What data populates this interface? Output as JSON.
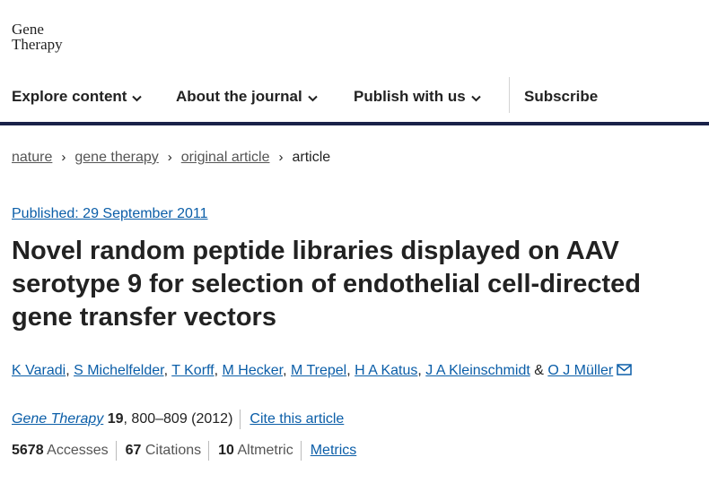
{
  "logo": {
    "line1": "Gene",
    "line2": "Therapy"
  },
  "nav": {
    "explore": "Explore content",
    "about": "About the journal",
    "publish": "Publish with us",
    "subscribe": "Subscribe"
  },
  "breadcrumb": {
    "items": [
      "nature",
      "gene therapy",
      "original article"
    ],
    "current": "article"
  },
  "article": {
    "published": "Published: 29 September 2011",
    "title": "Novel random peptide libraries displayed on AAV serotype 9 for selection of endothelial cell-directed gene transfer vectors",
    "authors": [
      "K Varadi",
      "S Michelfelder",
      "T Korff",
      "M Hecker",
      "M Trepel",
      "H A Katus",
      "J A Kleinschmidt",
      "O J Müller"
    ],
    "author_sep": ", ",
    "author_and": " & ",
    "journal": "Gene Therapy",
    "volume": "19",
    "pages": ", 800–809 (2012)",
    "cite_link": "Cite this article"
  },
  "metrics": {
    "accesses_value": "5678",
    "accesses_label": "Accesses",
    "citations_value": "67",
    "citations_label": "Citations",
    "altmetric_value": "10",
    "altmetric_label": "Altmetric",
    "metrics_link": "Metrics"
  },
  "icons": {
    "dropdown": "chevron-down-icon",
    "breadcrumb_sep": "chevron-right-icon",
    "corresponding": "envelope-icon"
  },
  "colors": {
    "link": "#0b5ea8",
    "nav_rule": "#1a2249",
    "text": "#222222"
  }
}
